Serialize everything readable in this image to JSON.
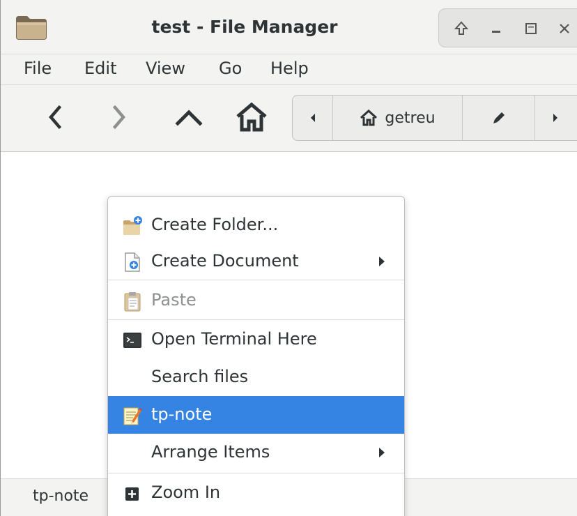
{
  "window": {
    "title": "test - File Manager",
    "icon": "folder-icon",
    "controls": [
      "up-icon",
      "minimize-icon",
      "maximize-icon",
      "close-icon"
    ]
  },
  "menubar": {
    "items": [
      "File",
      "Edit",
      "View",
      "Go",
      "Help"
    ]
  },
  "toolbar": {
    "buttons": [
      "back-arrow-icon",
      "forward-arrow-icon",
      "parent-folder-icon",
      "home-icon"
    ]
  },
  "pathbar": {
    "scroll_left": "triangle-left-icon",
    "home_label": "getreu",
    "edit": "pencil-icon",
    "scroll_right": "triangle-right-icon"
  },
  "context_menu": {
    "items": [
      {
        "label": "Create Folder...",
        "icon": "create-folder-icon",
        "enabled": true
      },
      {
        "label": "Create Document",
        "icon": "create-document-icon",
        "submenu": true,
        "enabled": true
      },
      {
        "label": "Paste",
        "icon": "paste-icon",
        "enabled": false
      },
      {
        "label": "Open Terminal Here",
        "icon": "terminal-icon",
        "enabled": true
      },
      {
        "label": "Search files",
        "enabled": true
      },
      {
        "label": "tp-note",
        "icon": "tp-note-icon",
        "enabled": true,
        "selected": true
      },
      {
        "label": "Arrange Items",
        "submenu": true,
        "enabled": true
      },
      {
        "label": "Zoom In",
        "icon": "zoom-in-icon",
        "enabled": true
      }
    ]
  },
  "statusbar": {
    "text": "tp-note"
  },
  "colors": {
    "selection": "#3584e4",
    "chrome": "#f3f3f2",
    "text": "#2e3436",
    "disabled_text": "#8d9091"
  }
}
